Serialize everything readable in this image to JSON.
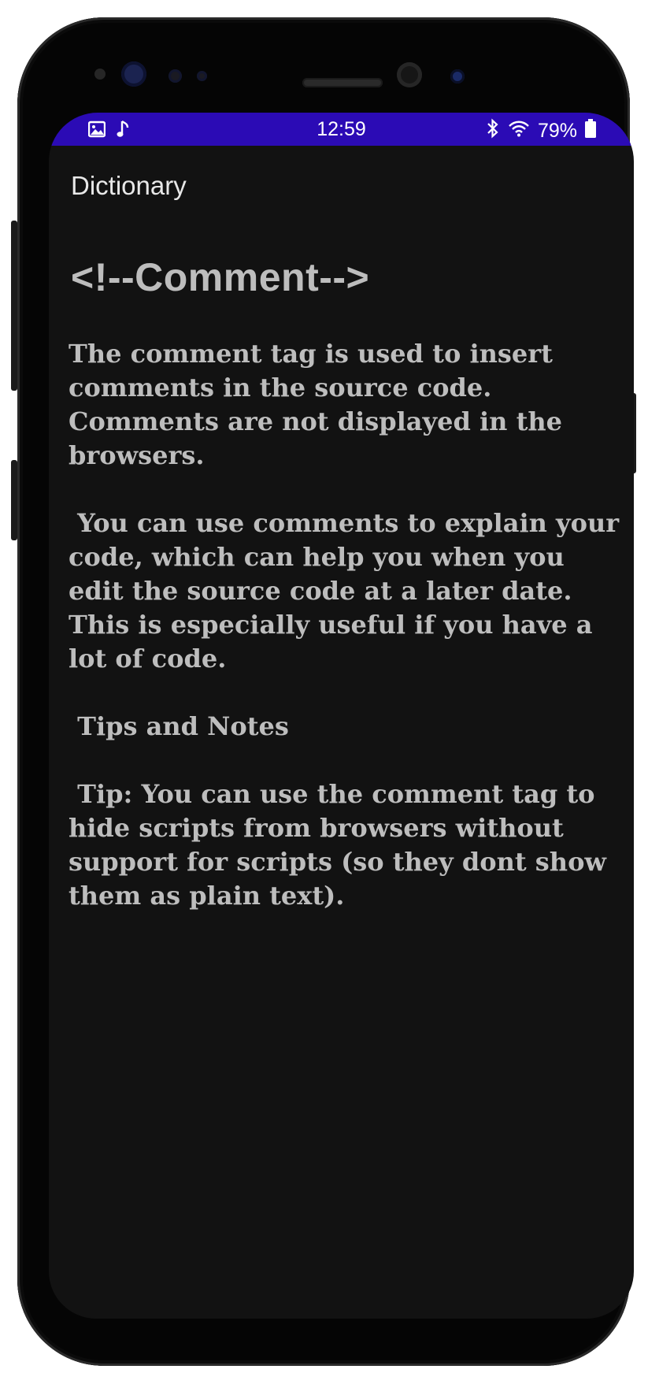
{
  "status_bar": {
    "time": "12:59",
    "battery": "79%",
    "left_icons": [
      "image-icon",
      "music-note-icon"
    ],
    "right_icons": [
      "bluetooth-icon",
      "wifi-icon",
      "battery-icon"
    ],
    "color": "#2b0bb5"
  },
  "app_bar": {
    "title": "Dictionary"
  },
  "entry": {
    "term": "<!--Comment-->",
    "description": "The comment tag is used to insert comments in the source code. Comments are not displayed in the browsers.\n\n You can use comments to explain your code, which can help you when you edit the source code at a later date. This is especially useful if you have a lot of code.\n\n Tips and Notes\n\n Tip: You can use the comment tag to hide scripts from browsers without support for scripts (so they dont show them as plain text)."
  },
  "theme": {
    "background": "#121212",
    "text": "#bdbdbd"
  }
}
